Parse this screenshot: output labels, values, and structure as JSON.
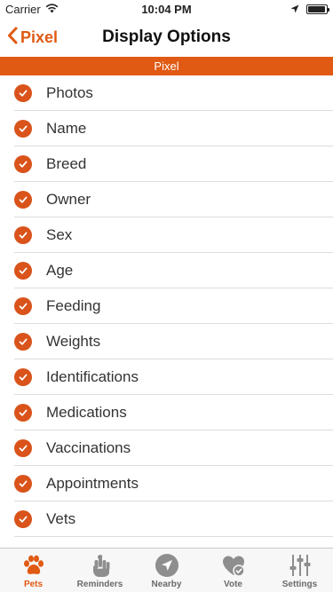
{
  "status_bar": {
    "carrier": "Carrier",
    "time": "10:04 PM",
    "battery_level": 0.95
  },
  "nav": {
    "back_label": "Pixel",
    "title": "Display Options"
  },
  "section": {
    "header": "Pixel"
  },
  "options": [
    {
      "label": "Photos",
      "checked": true
    },
    {
      "label": "Name",
      "checked": true
    },
    {
      "label": "Breed",
      "checked": true
    },
    {
      "label": "Owner",
      "checked": true
    },
    {
      "label": "Sex",
      "checked": true
    },
    {
      "label": "Age",
      "checked": true
    },
    {
      "label": "Feeding",
      "checked": true
    },
    {
      "label": "Weights",
      "checked": true
    },
    {
      "label": "Identifications",
      "checked": true
    },
    {
      "label": "Medications",
      "checked": true
    },
    {
      "label": "Vaccinations",
      "checked": true
    },
    {
      "label": "Appointments",
      "checked": true
    },
    {
      "label": "Vets",
      "checked": true
    }
  ],
  "tab_bar": {
    "tabs": [
      {
        "label": "Pets",
        "icon": "paw-icon",
        "active": true
      },
      {
        "label": "Reminders",
        "icon": "hand-string-icon",
        "active": false
      },
      {
        "label": "Nearby",
        "icon": "location-arrow-icon",
        "active": false
      },
      {
        "label": "Vote",
        "icon": "heart-check-icon",
        "active": false
      },
      {
        "label": "Settings",
        "icon": "sliders-icon",
        "active": false
      }
    ]
  },
  "colors": {
    "accent": "#e05a13",
    "check": "#d9531a",
    "inactive_tab": "#8e8e8e"
  }
}
